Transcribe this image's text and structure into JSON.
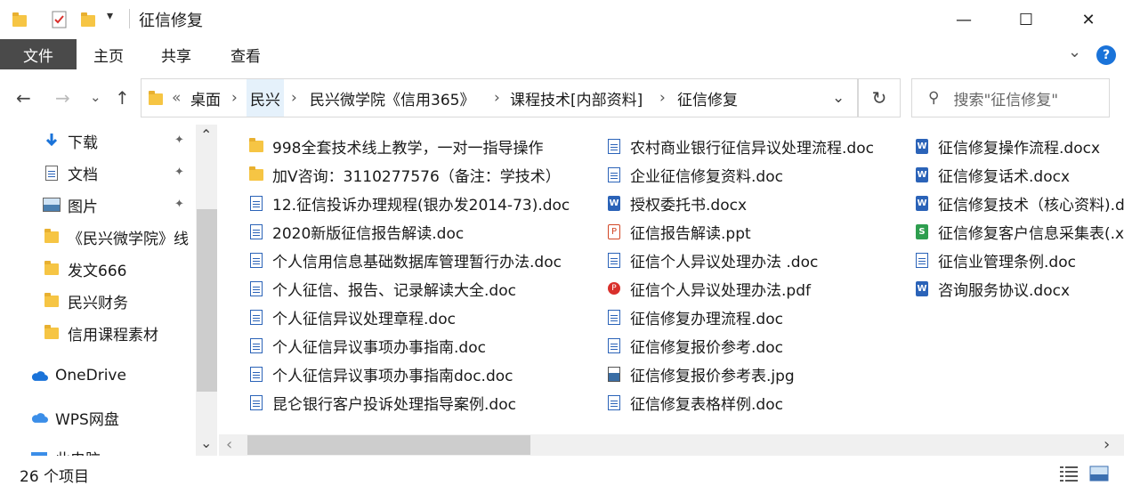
{
  "window": {
    "title": "征信修复",
    "quick_access_icons": [
      "folder-icon",
      "checkmark-document-icon",
      "folder-icon",
      "dropdown-arrow-icon"
    ],
    "controls": {
      "minimize": "—",
      "maximize": "☐",
      "close": "✕"
    }
  },
  "ribbon": {
    "tabs": [
      "文件",
      "主页",
      "共享",
      "查看"
    ],
    "active_tab": "文件",
    "collapse_icon": "⌄",
    "help_label": "?"
  },
  "nav": {
    "back": "←",
    "forward": "→",
    "recent": "⌄",
    "up": "↑",
    "overflow": "«",
    "breadcrumbs": [
      "桌面",
      "民兴",
      "民兴微学院《信用365》",
      "课程技术[内部资料]",
      "征信修复"
    ],
    "separator": "›",
    "dropdown": "⌄",
    "refresh": "↻",
    "search_placeholder": "搜索\"征信修复\""
  },
  "sidebar": {
    "items": [
      {
        "label": "下载",
        "icon": "download-arrow-icon",
        "pinned": true
      },
      {
        "label": "文档",
        "icon": "documents-icon",
        "pinned": true
      },
      {
        "label": "图片",
        "icon": "pictures-icon",
        "pinned": true
      },
      {
        "label": "《民兴微学院》线",
        "icon": "folder-icon",
        "pinned": false
      },
      {
        "label": "发文666",
        "icon": "folder-icon",
        "pinned": false
      },
      {
        "label": "民兴财务",
        "icon": "folder-icon",
        "pinned": false
      },
      {
        "label": "信用课程素材",
        "icon": "folder-icon",
        "pinned": false
      },
      {
        "label": "OneDrive",
        "icon": "cloud-icon",
        "pinned": false
      },
      {
        "label": "WPS网盘",
        "icon": "cloud-icon",
        "pinned": false
      },
      {
        "label": "此电脑",
        "icon": "computer-icon",
        "pinned": false
      }
    ],
    "pin_glyph": "📌",
    "scroll_up": "⌃",
    "scroll_down": "⌄"
  },
  "files": {
    "columns": [
      [
        {
          "name": "998全套技术线上教学，一对一指导操作",
          "type": "folder"
        },
        {
          "name": "加V咨询：3110277576（备注：学技术）",
          "type": "folder"
        },
        {
          "name": "12.征信投诉办理规程(银办发2014-73).doc",
          "type": "doc"
        },
        {
          "name": "2020新版征信报告解读.doc",
          "type": "doc"
        },
        {
          "name": "个人信用信息基础数据库管理暂行办法.doc",
          "type": "doc"
        },
        {
          "name": "个人征信、报告、记录解读大全.doc",
          "type": "doc"
        },
        {
          "name": "个人征信异议处理章程.doc",
          "type": "doc"
        },
        {
          "name": "个人征信异议事项办事指南.doc",
          "type": "doc"
        },
        {
          "name": "个人征信异议事项办事指南doc.doc",
          "type": "doc"
        },
        {
          "name": "昆仑银行客户投诉处理指导案例.doc",
          "type": "doc"
        }
      ],
      [
        {
          "name": "农村商业银行征信异议处理流程.doc",
          "type": "doc"
        },
        {
          "name": "企业征信修复资料.doc",
          "type": "doc"
        },
        {
          "name": "授权委托书.docx",
          "type": "docx"
        },
        {
          "name": "征信报告解读.ppt",
          "type": "ppt"
        },
        {
          "name": "征信个人异议处理办法 .doc",
          "type": "doc"
        },
        {
          "name": "征信个人异议处理办法.pdf",
          "type": "pdf"
        },
        {
          "name": "征信修复办理流程.doc",
          "type": "doc"
        },
        {
          "name": "征信修复报价参考.doc",
          "type": "doc"
        },
        {
          "name": "征信修复报价参考表.jpg",
          "type": "jpg"
        },
        {
          "name": "征信修复表格样例.doc",
          "type": "doc"
        }
      ],
      [
        {
          "name": "征信修复操作流程.docx",
          "type": "docx"
        },
        {
          "name": "征信修复话术.docx",
          "type": "docx"
        },
        {
          "name": "征信修复技术（核心资料).docx",
          "type": "docx"
        },
        {
          "name": "征信修复客户信息采集表(.xlsx",
          "type": "xlsx"
        },
        {
          "name": "征信业管理条例.doc",
          "type": "doc"
        },
        {
          "name": "咨询服务协议.docx",
          "type": "docx"
        }
      ]
    ]
  },
  "hscroll": {
    "left": "‹",
    "right": "›"
  },
  "status": {
    "item_count": "26 个项目",
    "view_details_icon": "details-view-icon",
    "view_tiles_icon": "large-icons-view-icon"
  },
  "colors": {
    "file_tab_bg": "#4a4a4a",
    "folder": "#f6c544",
    "doc_blue": "#2b63b8",
    "help_blue": "#1a73d9"
  }
}
